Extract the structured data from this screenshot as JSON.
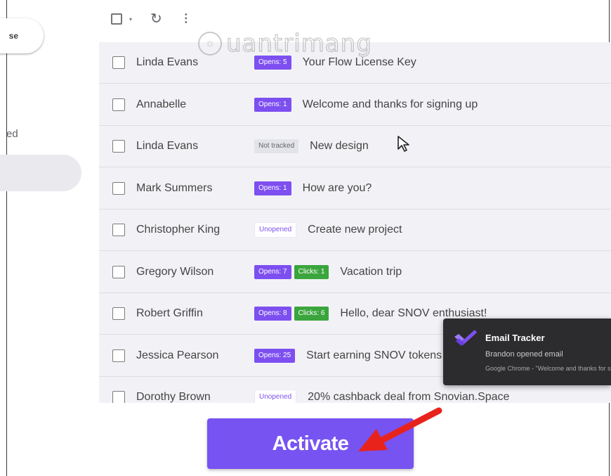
{
  "sidebar": {
    "compose_fragment": "se",
    "label_fragment": "ed"
  },
  "toolbar": {
    "checkbox_icon": "checkbox-icon",
    "caret_icon": "caret-down-icon",
    "refresh_icon": "refresh-icon",
    "more_icon": "more-vert-icon",
    "caret_glyph": "▾",
    "refresh_glyph": "↻",
    "more_glyph": "⋮"
  },
  "watermark": {
    "text": "uantrimang",
    "bulb_glyph": "☼"
  },
  "emails": [
    {
      "sender": "Linda Evans",
      "tags": [
        {
          "label": "Opens: 5",
          "kind": "opens"
        }
      ],
      "subject": "Your Flow License Key"
    },
    {
      "sender": "Annabelle",
      "tags": [
        {
          "label": "Opens: 1",
          "kind": "opens"
        }
      ],
      "subject": "Welcome and thanks  for signing up"
    },
    {
      "sender": "Linda Evans",
      "tags": [
        {
          "label": "Not tracked",
          "kind": "untracked"
        }
      ],
      "subject": "New design"
    },
    {
      "sender": "Mark Summers",
      "tags": [
        {
          "label": "Opens: 1",
          "kind": "opens"
        }
      ],
      "subject": "How are you?"
    },
    {
      "sender": "Christopher King",
      "tags": [
        {
          "label": "Unopened",
          "kind": "unopened"
        }
      ],
      "subject": "Create new project"
    },
    {
      "sender": "Gregory Wilson",
      "tags": [
        {
          "label": "Opens: 7",
          "kind": "opens"
        },
        {
          "label": "Clicks: 1",
          "kind": "clicks"
        }
      ],
      "subject": "Vacation trip"
    },
    {
      "sender": "Robert Griffin",
      "tags": [
        {
          "label": "Opens: 8",
          "kind": "opens"
        },
        {
          "label": "Clicks: 6",
          "kind": "clicks"
        }
      ],
      "subject": "Hello, dear SNOV enthusiast!"
    },
    {
      "sender": "Jessica Pearson",
      "tags": [
        {
          "label": "Opens: 25",
          "kind": "opens"
        }
      ],
      "subject": "Start earning SNOV tokens"
    },
    {
      "sender": "Dorothy Brown",
      "tags": [
        {
          "label": "Unopened",
          "kind": "unopened"
        }
      ],
      "subject": "20% cashback deal from Snovian.Space"
    }
  ],
  "notification": {
    "title": "Email Tracker",
    "body": "Brandon opened email",
    "source": "Google Chrome - \"Welcome and thanks for signing up\""
  },
  "activate_button": {
    "label": "Activate"
  },
  "colors": {
    "accent": "#7753f2",
    "opens_badge": "#7d4ff0",
    "clicks_badge": "#3ba53d",
    "toast_bg": "#2c2c2e",
    "arrow": "#e8231c"
  }
}
